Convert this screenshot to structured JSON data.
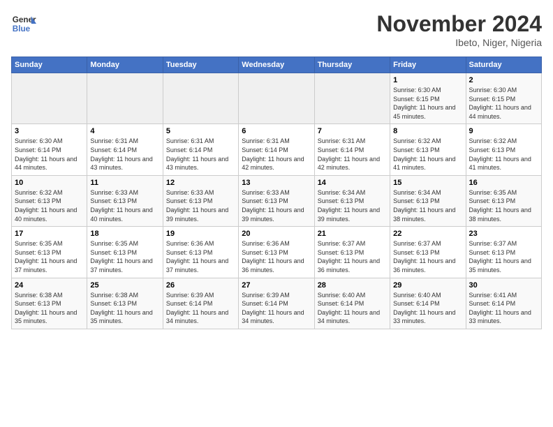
{
  "header": {
    "logo_line1": "General",
    "logo_line2": "Blue",
    "month": "November 2024",
    "location": "Ibeto, Niger, Nigeria"
  },
  "days_of_week": [
    "Sunday",
    "Monday",
    "Tuesday",
    "Wednesday",
    "Thursday",
    "Friday",
    "Saturday"
  ],
  "weeks": [
    [
      {
        "day": "",
        "info": ""
      },
      {
        "day": "",
        "info": ""
      },
      {
        "day": "",
        "info": ""
      },
      {
        "day": "",
        "info": ""
      },
      {
        "day": "",
        "info": ""
      },
      {
        "day": "1",
        "info": "Sunrise: 6:30 AM\nSunset: 6:15 PM\nDaylight: 11 hours and 45 minutes."
      },
      {
        "day": "2",
        "info": "Sunrise: 6:30 AM\nSunset: 6:15 PM\nDaylight: 11 hours and 44 minutes."
      }
    ],
    [
      {
        "day": "3",
        "info": "Sunrise: 6:30 AM\nSunset: 6:14 PM\nDaylight: 11 hours and 44 minutes."
      },
      {
        "day": "4",
        "info": "Sunrise: 6:31 AM\nSunset: 6:14 PM\nDaylight: 11 hours and 43 minutes."
      },
      {
        "day": "5",
        "info": "Sunrise: 6:31 AM\nSunset: 6:14 PM\nDaylight: 11 hours and 43 minutes."
      },
      {
        "day": "6",
        "info": "Sunrise: 6:31 AM\nSunset: 6:14 PM\nDaylight: 11 hours and 42 minutes."
      },
      {
        "day": "7",
        "info": "Sunrise: 6:31 AM\nSunset: 6:14 PM\nDaylight: 11 hours and 42 minutes."
      },
      {
        "day": "8",
        "info": "Sunrise: 6:32 AM\nSunset: 6:13 PM\nDaylight: 11 hours and 41 minutes."
      },
      {
        "day": "9",
        "info": "Sunrise: 6:32 AM\nSunset: 6:13 PM\nDaylight: 11 hours and 41 minutes."
      }
    ],
    [
      {
        "day": "10",
        "info": "Sunrise: 6:32 AM\nSunset: 6:13 PM\nDaylight: 11 hours and 40 minutes."
      },
      {
        "day": "11",
        "info": "Sunrise: 6:33 AM\nSunset: 6:13 PM\nDaylight: 11 hours and 40 minutes."
      },
      {
        "day": "12",
        "info": "Sunrise: 6:33 AM\nSunset: 6:13 PM\nDaylight: 11 hours and 39 minutes."
      },
      {
        "day": "13",
        "info": "Sunrise: 6:33 AM\nSunset: 6:13 PM\nDaylight: 11 hours and 39 minutes."
      },
      {
        "day": "14",
        "info": "Sunrise: 6:34 AM\nSunset: 6:13 PM\nDaylight: 11 hours and 39 minutes."
      },
      {
        "day": "15",
        "info": "Sunrise: 6:34 AM\nSunset: 6:13 PM\nDaylight: 11 hours and 38 minutes."
      },
      {
        "day": "16",
        "info": "Sunrise: 6:35 AM\nSunset: 6:13 PM\nDaylight: 11 hours and 38 minutes."
      }
    ],
    [
      {
        "day": "17",
        "info": "Sunrise: 6:35 AM\nSunset: 6:13 PM\nDaylight: 11 hours and 37 minutes."
      },
      {
        "day": "18",
        "info": "Sunrise: 6:35 AM\nSunset: 6:13 PM\nDaylight: 11 hours and 37 minutes."
      },
      {
        "day": "19",
        "info": "Sunrise: 6:36 AM\nSunset: 6:13 PM\nDaylight: 11 hours and 37 minutes."
      },
      {
        "day": "20",
        "info": "Sunrise: 6:36 AM\nSunset: 6:13 PM\nDaylight: 11 hours and 36 minutes."
      },
      {
        "day": "21",
        "info": "Sunrise: 6:37 AM\nSunset: 6:13 PM\nDaylight: 11 hours and 36 minutes."
      },
      {
        "day": "22",
        "info": "Sunrise: 6:37 AM\nSunset: 6:13 PM\nDaylight: 11 hours and 36 minutes."
      },
      {
        "day": "23",
        "info": "Sunrise: 6:37 AM\nSunset: 6:13 PM\nDaylight: 11 hours and 35 minutes."
      }
    ],
    [
      {
        "day": "24",
        "info": "Sunrise: 6:38 AM\nSunset: 6:13 PM\nDaylight: 11 hours and 35 minutes."
      },
      {
        "day": "25",
        "info": "Sunrise: 6:38 AM\nSunset: 6:13 PM\nDaylight: 11 hours and 35 minutes."
      },
      {
        "day": "26",
        "info": "Sunrise: 6:39 AM\nSunset: 6:14 PM\nDaylight: 11 hours and 34 minutes."
      },
      {
        "day": "27",
        "info": "Sunrise: 6:39 AM\nSunset: 6:14 PM\nDaylight: 11 hours and 34 minutes."
      },
      {
        "day": "28",
        "info": "Sunrise: 6:40 AM\nSunset: 6:14 PM\nDaylight: 11 hours and 34 minutes."
      },
      {
        "day": "29",
        "info": "Sunrise: 6:40 AM\nSunset: 6:14 PM\nDaylight: 11 hours and 33 minutes."
      },
      {
        "day": "30",
        "info": "Sunrise: 6:41 AM\nSunset: 6:14 PM\nDaylight: 11 hours and 33 minutes."
      }
    ]
  ]
}
